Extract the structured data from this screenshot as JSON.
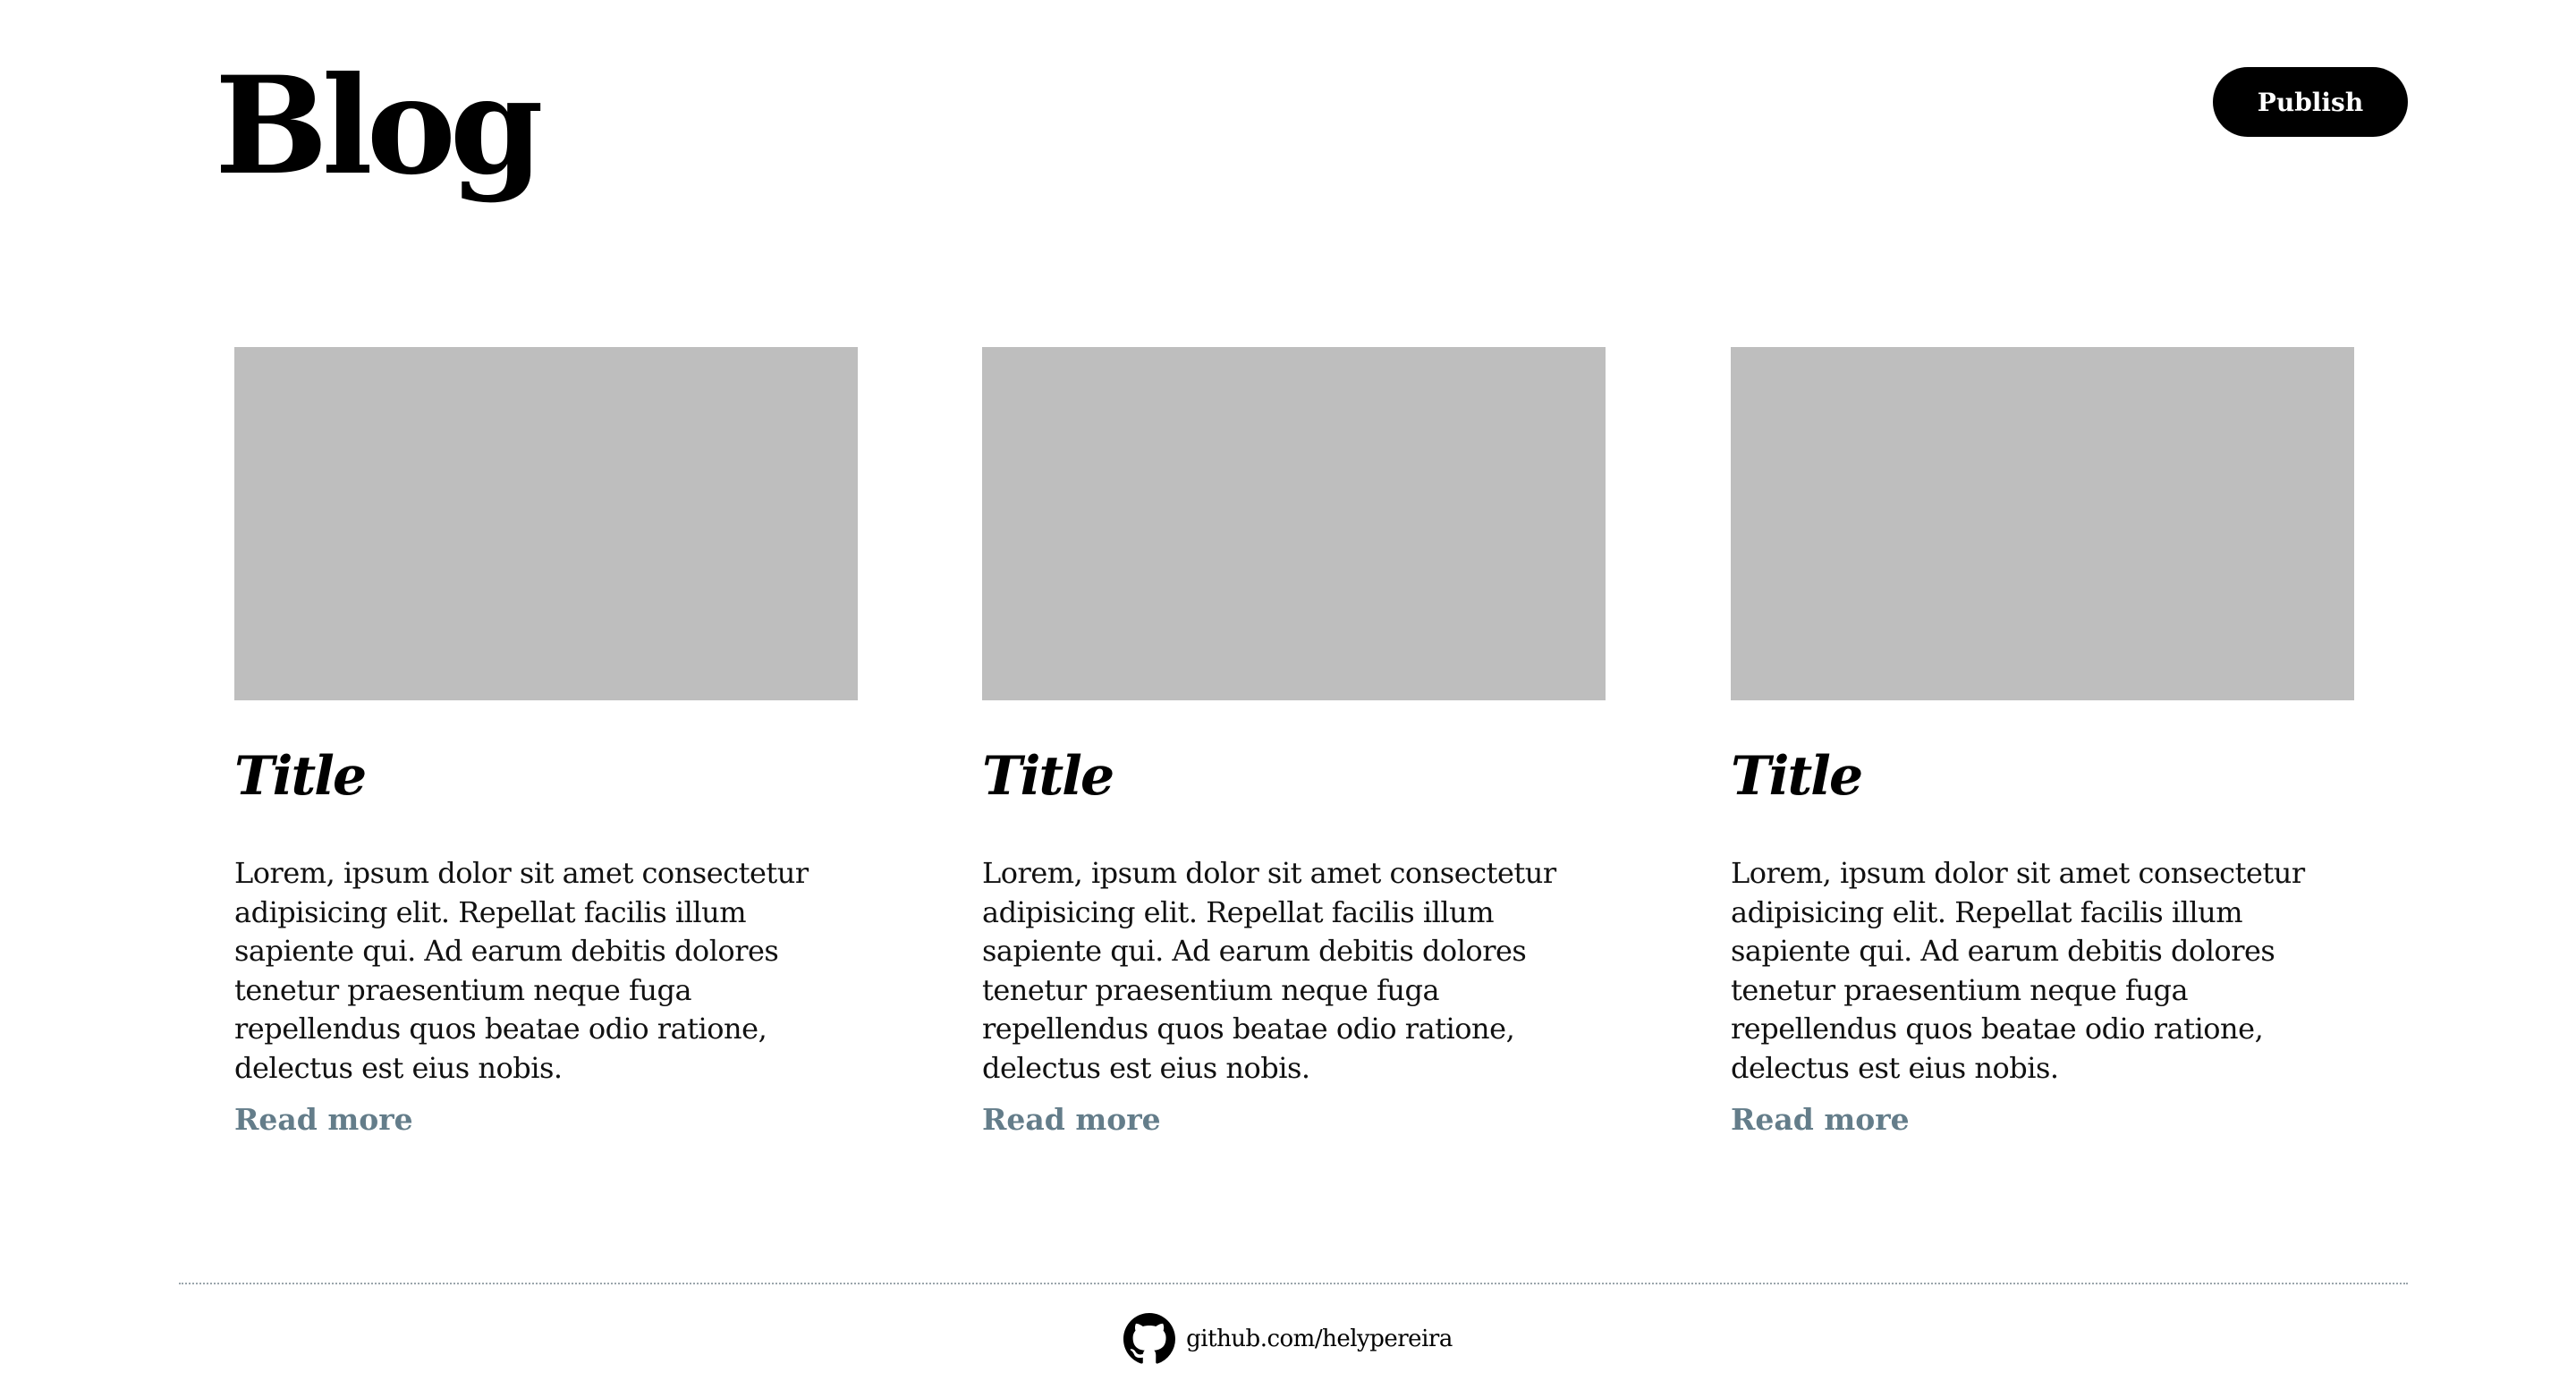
{
  "header": {
    "title": "Blog",
    "publish_label": "Publish"
  },
  "posts": [
    {
      "title": "Title",
      "excerpt": "Lorem, ipsum dolor sit amet consectetur adipisicing elit. Repellat facilis illum sapiente qui. Ad earum debitis dolores tenetur praesentium neque fuga repellendus quos beatae odio ratione, delectus est eius nobis.",
      "read_more": "Read more"
    },
    {
      "title": "Title",
      "excerpt": "Lorem, ipsum dolor sit amet consectetur adipisicing elit. Repellat facilis illum sapiente qui. Ad earum debitis dolores tenetur praesentium neque fuga repellendus quos beatae odio ratione, delectus est eius nobis.",
      "read_more": "Read more"
    },
    {
      "title": "Title",
      "excerpt": "Lorem, ipsum dolor sit amet consectetur adipisicing elit. Repellat facilis illum sapiente qui. Ad earum debitis dolores tenetur praesentium neque fuga repellendus quos beatae odio ratione, delectus est eius nobis.",
      "read_more": "Read more"
    }
  ],
  "footer": {
    "icon": "github-icon",
    "link_text": "github.com/helypereira"
  },
  "colors": {
    "background": "#ffffff",
    "text": "#000000",
    "button_bg": "#000000",
    "button_text": "#ffffff",
    "image_placeholder": "#bebebe",
    "link": "#647d8a",
    "divider": "#9aa5ab"
  }
}
